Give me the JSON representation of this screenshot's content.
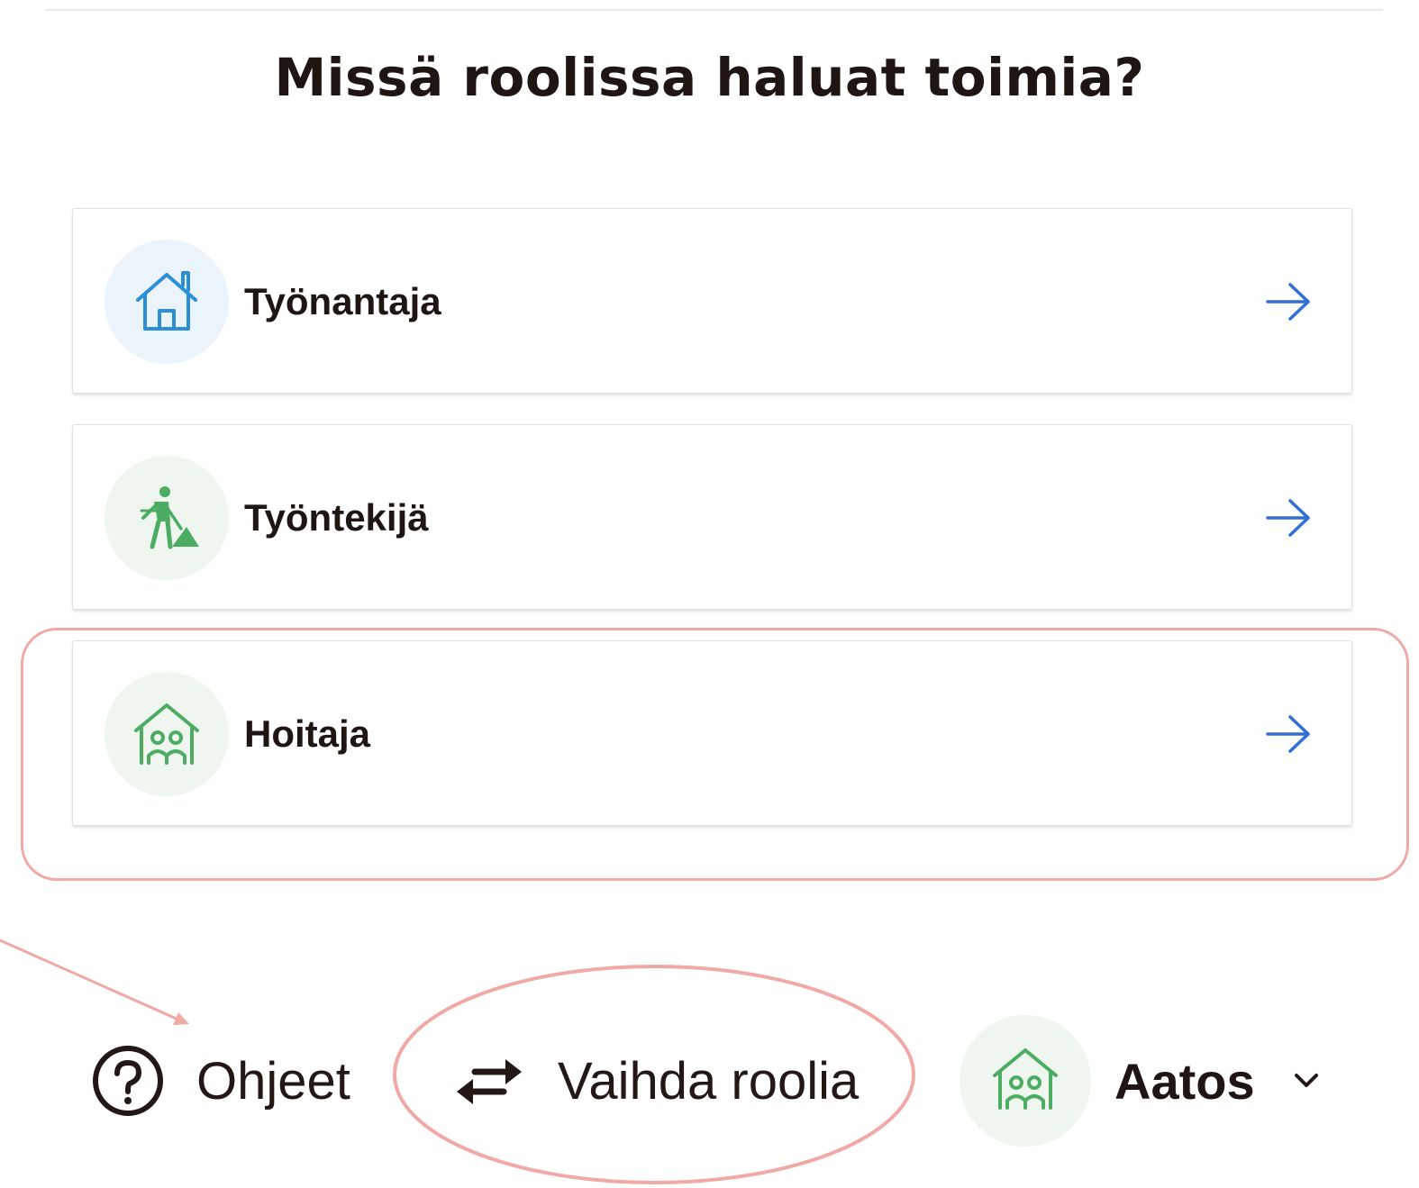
{
  "header": {
    "title": "Missä roolissa haluat toimia?"
  },
  "roles": [
    {
      "label": "Työnantaja",
      "icon": "house-icon",
      "icon_color": "#2b8fd6",
      "circle_color": "#eaf4fa"
    },
    {
      "label": "Työntekijä",
      "icon": "worker-shovel-icon",
      "icon_color": "#4cad62",
      "circle_color": "#eef6ef"
    },
    {
      "label": "Hoitaja",
      "icon": "family-house-icon",
      "icon_color": "#4cad62",
      "circle_color": "#eef6ef"
    }
  ],
  "footer": {
    "help_label": "Ohjeet",
    "switch_role_label": "Vaihda roolia",
    "user_name": "Aatos"
  },
  "colors": {
    "arrow": "#2f6fd6",
    "annotation": "#f1a9a5",
    "text": "#1f1614"
  }
}
